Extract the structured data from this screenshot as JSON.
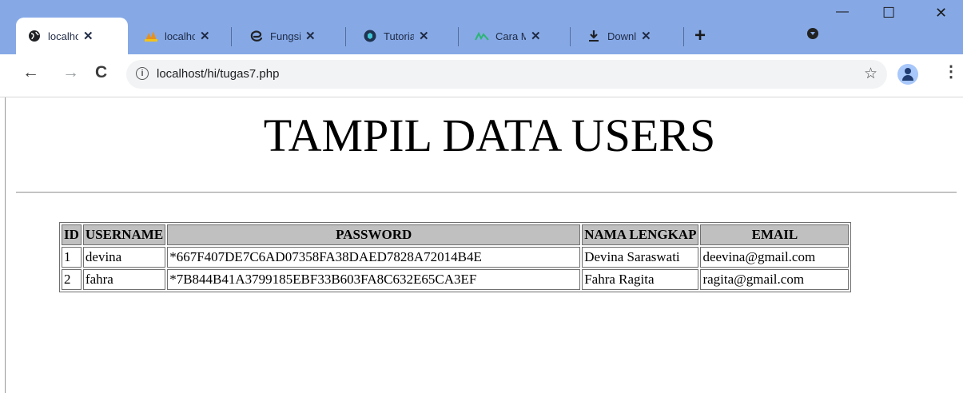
{
  "browser": {
    "tabs": [
      {
        "title": "localho",
        "icon": "globe-icon",
        "active": true
      },
      {
        "title": "localho",
        "icon": "phpmyadmin-icon",
        "active": false
      },
      {
        "title": "Fungsi",
        "icon": "edge-icon",
        "active": false
      },
      {
        "title": "Tutoria",
        "icon": "tutorial-icon",
        "active": false
      },
      {
        "title": "Cara M",
        "icon": "nuxt-icon",
        "active": false
      },
      {
        "title": "Downl",
        "icon": "download-icon",
        "active": false
      }
    ],
    "new_tab": "+",
    "address": "localhost/hi/tugas7.php"
  },
  "page": {
    "title": "TAMPIL DATA USERS",
    "table": {
      "headers": [
        "ID",
        "USERNAME",
        "PASSWORD",
        "NAMA LENGKAP",
        "EMAIL"
      ],
      "rows": [
        [
          "1",
          "devina",
          "*667F407DE7C6AD07358FA38DAED7828A72014B4E",
          "Devina Saraswati",
          "deevina@gmail.com"
        ],
        [
          "2",
          "fahra",
          "*7B844B41A3799185EBF33B603FA8C632E65CA3EF",
          "Fahra Ragita",
          "ragita@gmail.com"
        ]
      ]
    }
  },
  "colors": {
    "tabstrip": "#86a9e6",
    "table_header": "#c0c0c0"
  }
}
